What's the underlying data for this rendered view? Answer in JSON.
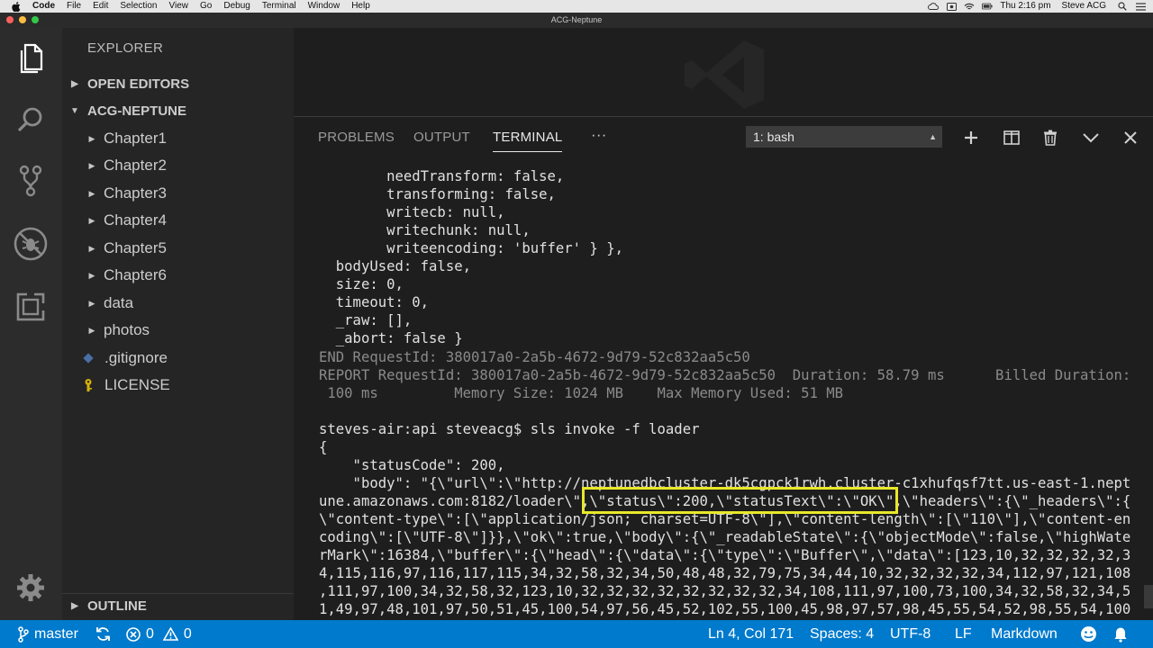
{
  "menubar": {
    "app_name": "Code",
    "items": [
      "File",
      "Edit",
      "Selection",
      "View",
      "Go",
      "Debug",
      "Terminal",
      "Window",
      "Help"
    ],
    "clock": "Thu 2:16 pm",
    "user": "Steve ACG"
  },
  "window": {
    "title": "ACG-Neptune"
  },
  "sidebar": {
    "title": "EXPLORER",
    "open_editors": "OPEN EDITORS",
    "project": "ACG-NEPTUNE",
    "folders": [
      "Chapter1",
      "Chapter2",
      "Chapter3",
      "Chapter4",
      "Chapter5",
      "Chapter6",
      "data",
      "photos"
    ],
    "files": [
      {
        "name": ".gitignore",
        "icon": "gitignore-icon",
        "color": "#4a6fa5"
      },
      {
        "name": "LICENSE",
        "icon": "license-icon",
        "color": "#d4b106"
      }
    ],
    "outline": "OUTLINE"
  },
  "panel": {
    "tabs": [
      "PROBLEMS",
      "OUTPUT",
      "TERMINAL"
    ],
    "active_tab": "TERMINAL",
    "more": "···",
    "terminal_select": "1: bash"
  },
  "terminal": {
    "lines": [
      {
        "text": "        needTransform: false,",
        "tone": "normal"
      },
      {
        "text": "        transforming: false,",
        "tone": "normal"
      },
      {
        "text": "        writecb: null,",
        "tone": "normal"
      },
      {
        "text": "        writechunk: null,",
        "tone": "normal"
      },
      {
        "text": "        writeencoding: 'buffer' } },",
        "tone": "normal"
      },
      {
        "text": "  bodyUsed: false,",
        "tone": "normal"
      },
      {
        "text": "  size: 0,",
        "tone": "normal"
      },
      {
        "text": "  timeout: 0,",
        "tone": "normal"
      },
      {
        "text": "  _raw: [],",
        "tone": "normal"
      },
      {
        "text": "  _abort: false }",
        "tone": "normal"
      },
      {
        "text": "END RequestId: 380017a0-2a5b-4672-9d79-52c832aa5c50",
        "tone": "gray"
      },
      {
        "text": "REPORT RequestId: 380017a0-2a5b-4672-9d79-52c832aa5c50  Duration: 58.79 ms      Billed Duration:",
        "tone": "gray"
      },
      {
        "text": " 100 ms         Memory Size: 1024 MB    Max Memory Used: 51 MB",
        "tone": "gray"
      },
      {
        "text": "",
        "tone": "normal"
      },
      {
        "text": "steves-air:api steveacg$ sls invoke -f loader",
        "tone": "normal"
      },
      {
        "text": "{",
        "tone": "normal"
      },
      {
        "text": "    \"statusCode\": 200,",
        "tone": "normal"
      },
      {
        "text": "    \"body\": \"{\\\"url\\\":\\\"http://neptunedbcluster-dk5cgpck1rwh.cluster-c1xhufqsf7tt.us-east-1.nept",
        "tone": "normal"
      },
      {
        "text": "une.amazonaws.com:8182/loader\\\",\\\"status\\\":200,\\\"statusText\\\":\\\"OK\\\",\\\"headers\\\":{\\\"_headers\\\":{",
        "tone": "normal"
      },
      {
        "text": "\\\"content-type\\\":[\\\"application/json; charset=UTF-8\\\"],\\\"content-length\\\":[\\\"110\\\"],\\\"content-en",
        "tone": "normal"
      },
      {
        "text": "coding\\\":[\\\"UTF-8\\\"]}},\\\"ok\\\":true,\\\"body\\\":{\\\"_readableState\\\":{\\\"objectMode\\\":false,\\\"highWate",
        "tone": "normal"
      },
      {
        "text": "rMark\\\":16384,\\\"buffer\\\":{\\\"head\\\":{\\\"data\\\":{\\\"type\\\":\\\"Buffer\\\",\\\"data\\\":[123,10,32,32,32,32,3",
        "tone": "normal"
      },
      {
        "text": "4,115,116,97,116,117,115,34,32,58,32,34,50,48,48,32,79,75,34,44,10,32,32,32,32,34,112,97,121,108",
        "tone": "normal"
      },
      {
        "text": ",111,97,100,34,32,58,32,123,10,32,32,32,32,32,32,32,32,34,108,111,97,100,73,100,34,32,58,32,34,5",
        "tone": "normal"
      },
      {
        "text": "1,49,97,48,101,97,50,51,45,100,54,97,56,45,52,102,55,100,45,98,97,57,98,45,55,54,52,98,55,54,100",
        "tone": "normal"
      }
    ]
  },
  "statusbar": {
    "branch": "master",
    "errors": "0",
    "warnings": "0",
    "position": "Ln 4, Col 171",
    "spaces": "Spaces: 4",
    "encoding": "UTF-8",
    "eol": "LF",
    "language": "Markdown"
  },
  "colors": {
    "accent": "#007acc",
    "highlight_box": "#e8e82a"
  }
}
